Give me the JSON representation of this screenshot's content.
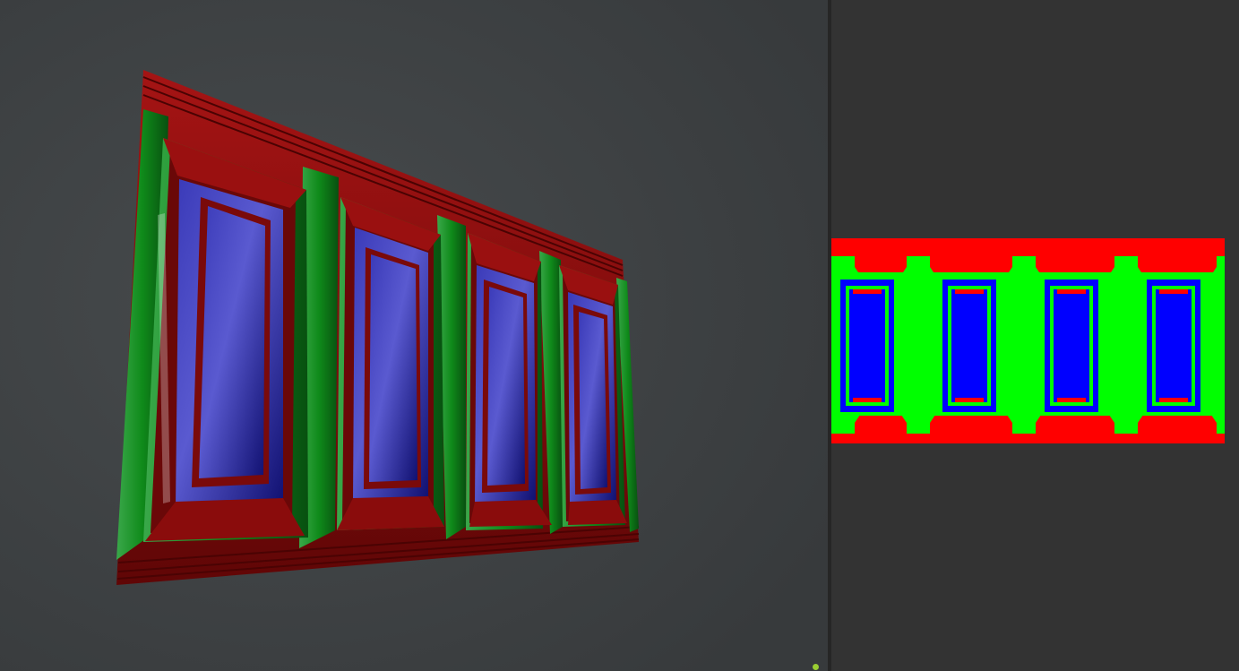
{
  "colors": {
    "viewport_bg_light": "#474b4d",
    "viewport_bg_dark": "#373a3c",
    "panel_bg": "#333333",
    "splitter": "#262626",
    "mask_red": "#ff0000",
    "mask_green": "#00ff00",
    "mask_blue": "#0000ff",
    "shaded_red": "#8a0a0a",
    "shaded_red_dark": "#5a0505",
    "shaded_green": "#0f8a1a",
    "shaded_green_dark": "#0a5c12",
    "shaded_blue": "#151590",
    "shaded_blue_dark": "#0a0a5c",
    "gizmo_dot": "#9acd32"
  },
  "viewport": {
    "content": "3d-mesh-wall-panel",
    "panel_count": 4
  },
  "texture_preview": {
    "content": "color-id-mask",
    "panel_count": 4
  },
  "icons": {
    "gizmo": "origin-dot-icon"
  }
}
